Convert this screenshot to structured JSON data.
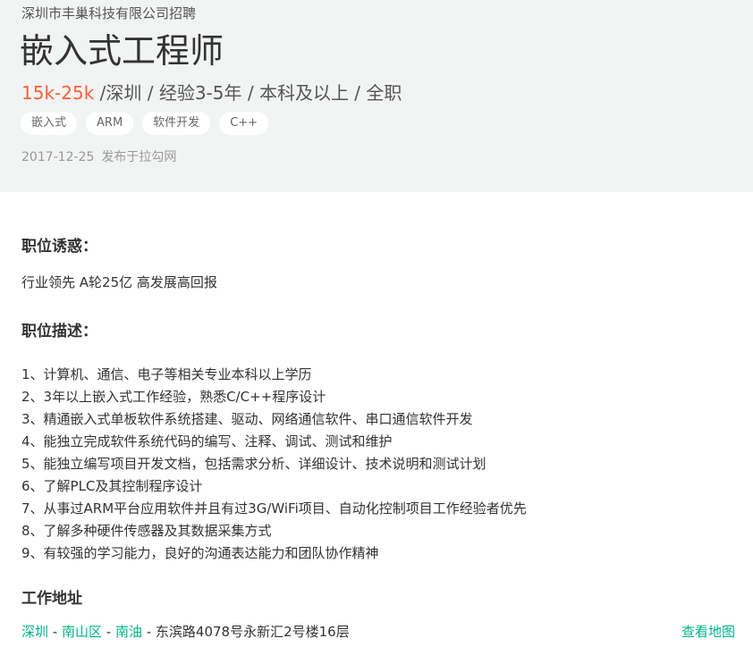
{
  "header": {
    "company": "深圳市丰巢科技有限公司招聘",
    "title": "嵌入式工程师",
    "salary": "15k-25k",
    "meta_rest": " /深圳 / 经验3-5年 / 本科及以上 / 全职",
    "tags": [
      "嵌入式",
      "ARM",
      "软件开发",
      "C++"
    ],
    "publish_date": "2017-12-25",
    "publish_source": "发布于拉勾网"
  },
  "perks": {
    "heading": "职位诱惑：",
    "text": "行业领先 A轮25亿 高发展高回报"
  },
  "description": {
    "heading": "职位描述：",
    "items": [
      "1、计算机、通信、电子等相关专业本科以上学历",
      "2、3年以上嵌入式工作经验，熟悉C/C++程序设计",
      "3、精通嵌入式单板软件系统搭建、驱动、网络通信软件、串口通信软件开发",
      "4、能独立完成软件系统代码的编写、注释、调试、测试和维护",
      "5、能独立编写项目开发文档，包括需求分析、详细设计、技术说明和测试计划",
      "6、了解PLC及其控制程序设计",
      "7、从事过ARM平台应用软件并且有过3G/WiFi项目、自动化控制项目工作经验者优先",
      "8、了解多种硬件传感器及其数据采集方式",
      "9、有较强的学习能力，良好的沟通表达能力和团队协作精神"
    ]
  },
  "address": {
    "heading": "工作地址",
    "city": "深圳",
    "district": "南山区",
    "area": "南油",
    "separator": " - ",
    "street": "东滨路4078号永新汇2号楼16层",
    "map_link": "查看地图"
  },
  "colors": {
    "accent_green": "#00b38a",
    "salary_orange": "#fd5f39",
    "header_bg": "#f2f3f3"
  }
}
